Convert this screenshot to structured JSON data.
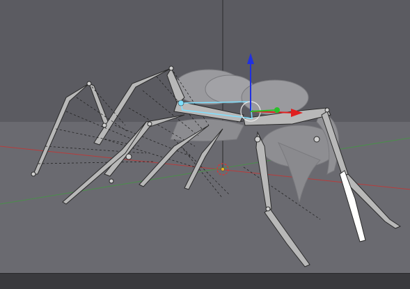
{
  "viewport": {
    "name": "3D Viewport",
    "mode": "pose",
    "overlay_text": "",
    "colors": {
      "background_top": "#55555b",
      "background_bottom": "#69696f",
      "x_axis": "#b83c3c",
      "y_axis": "#4a8f4a",
      "z_axis_line": "#2a2a2a",
      "bone_fill": "#b8b8b8",
      "bone_outline": "#2a2a2a",
      "selected_bone": "#7fe0ff",
      "active_bone": "#ffffff",
      "mesh": "#9a9a9e",
      "gizmo_x": "#e02020",
      "gizmo_y": "#2ac02a",
      "gizmo_z": "#2030e0",
      "cursor_3d": "#e03030"
    },
    "icons": [
      "transform-gizmo-icon",
      "3d-cursor-icon"
    ]
  },
  "bottom_bar": {
    "label": ""
  }
}
